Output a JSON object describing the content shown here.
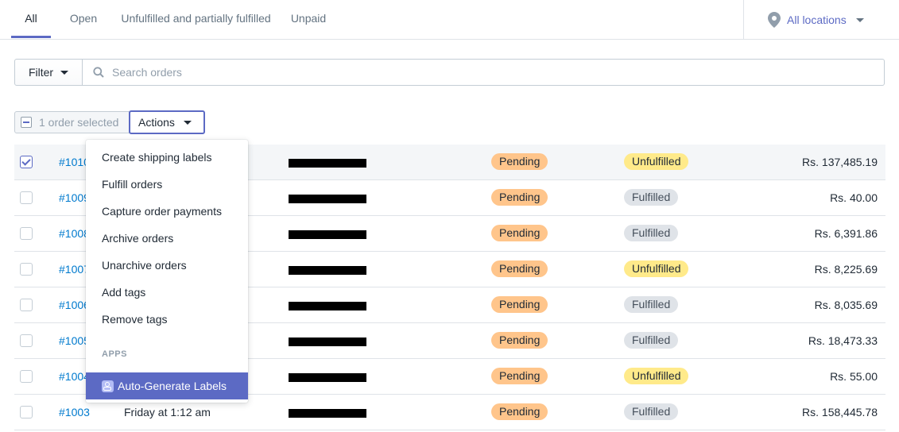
{
  "tabs": [
    {
      "label": "All",
      "active": true
    },
    {
      "label": "Open",
      "active": false
    },
    {
      "label": "Unfulfilled and partially fulfilled",
      "active": false
    },
    {
      "label": "Unpaid",
      "active": false
    }
  ],
  "location": {
    "label": "All locations",
    "icon": "map-pin-icon"
  },
  "filter": {
    "label": "Filter"
  },
  "search": {
    "placeholder": "Search orders"
  },
  "bulk": {
    "selected_text": "1 order selected",
    "actions_label": "Actions"
  },
  "actions_menu": {
    "items": [
      "Create shipping labels",
      "Fulfill orders",
      "Capture order payments",
      "Archive orders",
      "Unarchive orders",
      "Add tags",
      "Remove tags"
    ],
    "section_label": "APPS",
    "app_item": "Auto-Generate Labels"
  },
  "orders": [
    {
      "order": "#1010",
      "date": "",
      "payment": "Pending",
      "fulfillment": "Unfulfilled",
      "total": "Rs. 137,485.19",
      "selected": true
    },
    {
      "order": "#1009",
      "date": "",
      "payment": "Pending",
      "fulfillment": "Fulfilled",
      "total": "Rs. 40.00",
      "selected": false
    },
    {
      "order": "#1008",
      "date": "",
      "payment": "Pending",
      "fulfillment": "Fulfilled",
      "total": "Rs. 6,391.86",
      "selected": false
    },
    {
      "order": "#1007",
      "date": "",
      "payment": "Pending",
      "fulfillment": "Unfulfilled",
      "total": "Rs. 8,225.69",
      "selected": false
    },
    {
      "order": "#1006",
      "date": "",
      "payment": "Pending",
      "fulfillment": "Fulfilled",
      "total": "Rs. 8,035.69",
      "selected": false
    },
    {
      "order": "#1005",
      "date": "",
      "payment": "Pending",
      "fulfillment": "Fulfilled",
      "total": "Rs. 18,473.33",
      "selected": false
    },
    {
      "order": "#1004",
      "date": "",
      "payment": "Pending",
      "fulfillment": "Unfulfilled",
      "total": "Rs. 55.00",
      "selected": false
    },
    {
      "order": "#1003",
      "date": "Friday at 1:12 am",
      "payment": "Pending",
      "fulfillment": "Fulfilled",
      "total": "Rs. 158,445.78",
      "selected": false
    }
  ],
  "colors": {
    "accent": "#5c6ac4",
    "link": "#007ace",
    "pending": "#ffc58b",
    "unfulfilled": "#ffea8a",
    "fulfilled": "#dfe3e8"
  }
}
